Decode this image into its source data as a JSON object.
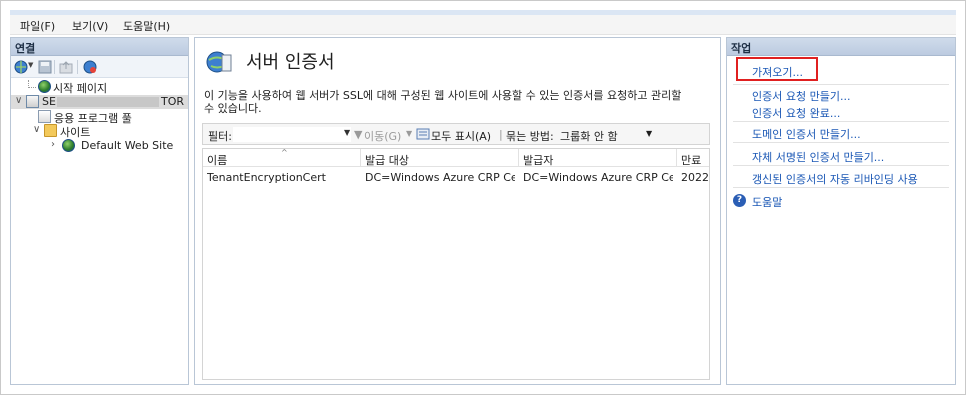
{
  "menu": [
    "파일(F)",
    "보기(V)",
    "도움말(H)"
  ],
  "left": {
    "title": "연결",
    "tree": {
      "start_page": "시작 페이지",
      "server": "SE",
      "server_suffix": "TOR",
      "app_pools": "응용 프로그램 풀",
      "sites": "사이트",
      "default_site": "Default Web Site"
    }
  },
  "center": {
    "title": "서버 인증서",
    "description_line1": "이 기능을 사용하여 웹 서버가 SSL에 대해 구성된 웹 사이트에 사용할 수 있는 인증서를 요청하고 관리할",
    "description_line2": "수 있습니다.",
    "filter": {
      "label": "필터:",
      "go": "이동(G)",
      "show_all": "모두 표시(A)",
      "group_by_label": "묶는 방법:",
      "group_by_value": "그룹화 안 함"
    },
    "columns": [
      "이름",
      "발급 대상",
      "발급자",
      "만료"
    ],
    "rows": [
      {
        "name": "TenantEncryptionCert",
        "issued_to": "DC=Windows Azure CRP Cer...",
        "issuer": "DC=Windows Azure CRP Cer...",
        "expires": "2022"
      }
    ]
  },
  "right": {
    "title": "작업",
    "actions": {
      "import": "가져오기...",
      "create_request": "인증서 요청 만들기...",
      "complete_request": "인증서 요청 완료...",
      "create_domain": "도메인 인증서 만들기...",
      "create_self_signed": "자체 서명된 인증서 만들기...",
      "auto_rebind": "갱신된 인증서의 자동 리바인딩 사용",
      "help": "도움말"
    }
  },
  "colors": {
    "link": "#1a57b5",
    "highlight_box": "#e02020",
    "pane_header": "#c8d6e9"
  }
}
